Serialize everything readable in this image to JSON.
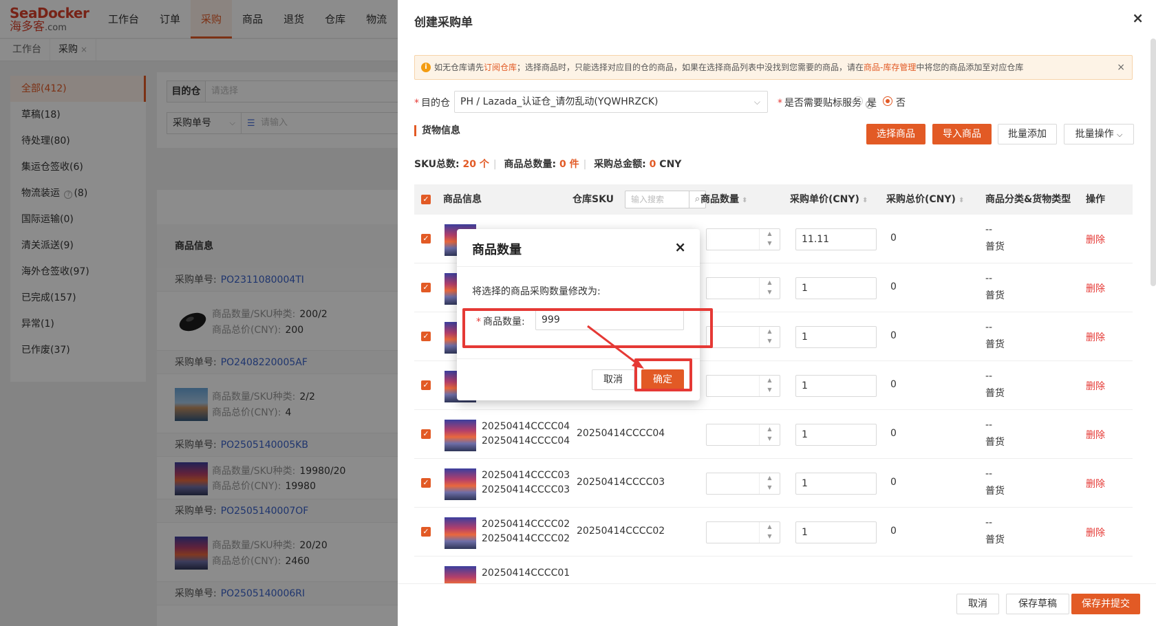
{
  "logo": {
    "name": "SeaDocker",
    "cn": "海多客",
    "suffix": ".com"
  },
  "nav": [
    "工作台",
    "订单",
    "采购",
    "商品",
    "退货",
    "仓库",
    "物流"
  ],
  "tabs": [
    {
      "label": "工作台"
    },
    {
      "label": "采购",
      "close": "×"
    }
  ],
  "left_items": [
    {
      "label": "全部(412)"
    },
    {
      "label": "草稿(18)"
    },
    {
      "label": "待处理(80)"
    },
    {
      "label": "集运仓签收(6)"
    },
    {
      "label": "物流装运",
      "suffix": "(8)"
    },
    {
      "label": "国际运输(0)"
    },
    {
      "label": "清关派送(9)"
    },
    {
      "label": "海外仓签收(97)"
    },
    {
      "label": "已完成(157)"
    },
    {
      "label": "异常(1)"
    },
    {
      "label": "已作废(37)"
    }
  ],
  "filter": {
    "dest_label": "目的仓",
    "dest_placeholder": "请选择",
    "type_label": "采购单号",
    "type_placeholder": "请输入"
  },
  "orders": {
    "header": "商品信息",
    "po_label": "采购单号:",
    "qty_label": "商品数量/SKU种类:",
    "total_label": "商品总价(CNY):",
    "list": [
      {
        "no": "PO2311080004TI",
        "qty": "200/2",
        "total": "200"
      },
      {
        "no": "PO2408220005AF",
        "qty": "2/2",
        "total": "4"
      },
      {
        "no": "PO2505140005KB",
        "qty": "19980/20",
        "total": "19980"
      },
      {
        "no": "PO2505140007OF",
        "qty": "20/20",
        "total": "2460"
      },
      {
        "no": "PO2505140006RI"
      }
    ]
  },
  "drawer": {
    "title": "创建采购单",
    "close": "×",
    "notice": {
      "icon": "i",
      "p1": "如无仓库请先",
      "link1": "订阅仓库",
      "p2": "；选择商品时，只能选择对应目的仓的商品，如果在选择商品列表中没找到您需要的商品，请在",
      "link2": "商品-库存管理",
      "p3": "中将您的商品添加至对应仓库",
      "close": "×"
    },
    "dest_label": "目的仓",
    "dest_value": "PH / Lazada_认证仓_请勿乱动(YQWHRZCK)",
    "label_service": "是否需要贴标服务",
    "yes": "是",
    "no": "否",
    "section": "货物信息",
    "btn_select": "选择商品",
    "btn_import": "导入商品",
    "btn_batch_add": "批量添加",
    "btn_batch_ops": "批量操作",
    "sum_sku_label": "SKU总数:",
    "sum_sku_value": "20",
    "sum_sku_unit": "个",
    "sum_qty_label": "商品总数量:",
    "sum_qty_value": "0",
    "sum_qty_unit": "件",
    "sum_amt_label": "采购总金额:",
    "sum_amt_value": "0",
    "sum_amt_unit": "CNY",
    "columns": {
      "product": "商品信息",
      "wsku": "仓库SKU",
      "search_ph": "输入搜索",
      "qty": "商品数量",
      "price": "采购单价(CNY)",
      "total": "采购总价(CNY)",
      "category": "商品分类&货物类型",
      "ops": "操作"
    },
    "rows": [
      {
        "sku": "",
        "wsku": "",
        "price": "11.11",
        "total": "0",
        "cat": "--",
        "type": "普货",
        "del": "删除"
      },
      {
        "sku": "",
        "wsku": "",
        "price": "1",
        "total": "0",
        "cat": "--",
        "type": "普货",
        "del": "删除"
      },
      {
        "sku": "",
        "wsku": "",
        "price": "1",
        "total": "0",
        "cat": "--",
        "type": "普货",
        "del": "删除"
      },
      {
        "sku": "",
        "wsku": "",
        "price": "1",
        "total": "0",
        "cat": "--",
        "type": "普货",
        "del": "删除"
      },
      {
        "sku": "20250414CCCC04",
        "wsku": "20250414CCCC04",
        "price": "1",
        "total": "0",
        "cat": "--",
        "type": "普货",
        "del": "删除"
      },
      {
        "sku": "20250414CCCC03",
        "wsku": "20250414CCCC03",
        "price": "1",
        "total": "0",
        "cat": "--",
        "type": "普货",
        "del": "删除"
      },
      {
        "sku": "20250414CCCC02",
        "wsku": "20250414CCCC02",
        "price": "1",
        "total": "0",
        "cat": "--",
        "type": "普货",
        "del": "删除"
      },
      {
        "sku": "20250414CCCC01",
        "wsku": "",
        "price": "",
        "total": "",
        "cat": "",
        "type": "",
        "del": ""
      }
    ],
    "footer": {
      "cancel": "取消",
      "draft": "保存草稿",
      "submit": "保存并提交"
    }
  },
  "modal": {
    "title": "商品数量",
    "close": "×",
    "desc": "将选择的商品采购数量修改为:",
    "field_label": "商品数量:",
    "field_value": "999",
    "cancel": "取消",
    "ok": "确定"
  },
  "colors": {
    "accent": "#e25a25",
    "danger": "#e53935",
    "link": "#3a62c9",
    "highlight": "#e53935"
  }
}
